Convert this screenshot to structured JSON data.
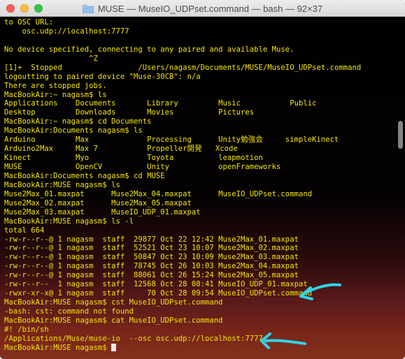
{
  "window": {
    "title": "MUSE — MuseIO_UDPset.command — bash — 92×37",
    "icon": "folder-icon"
  },
  "terminal": {
    "lines": [
      "to OSC URL:",
      "    osc.udp://localhost:7777",
      "",
      "No device specified, connecting to any paired and available Muse.",
      "                   ^Z",
      "[1]+  Stopped                 /Users/nagasm/Documents/MUSE/MuseIO_UDPset.command",
      "logoutting to paired device \"Muse-30CB\": n/a",
      "There are stopped jobs.",
      "MacBookAir:~ nagasm$ ls",
      "Applications    Documents       Library         Music           Public",
      "Desktop         Downloads       Movies          Pictures",
      "MacBookAir:~ nagasm$ cd Documents",
      "MacBookAir:Documents nagasm$ ls",
      "Arduino         Max             Processing      Unity勉強会     simpleKinect",
      "Arduino2Max     Max 7           Propeller開発   Xcode",
      "Kinect          Myo             Toyota          leapmotion",
      "MUSE            OpenCV          Unity           openFrameworks",
      "MacBookAir:Documents nagasm$ cd MUSE",
      "MacBookAir:MUSE nagasm$ ls",
      "Muse2Max_01.maxpat      Muse2Max_04.maxpat      MuseIO_UDPset.command",
      "Muse2Max_02.maxpat      Muse2Max_05.maxpat",
      "Muse2Max_03.maxpat      MuseIO_UDP_01.maxpat",
      "MacBookAir:MUSE nagasm$ ls -l",
      "total 664",
      "-rw-r--r--@ 1 nagasm  staff  29877 Oct 22 12:42 Muse2Max_01.maxpat",
      "-rw-r--r--@ 1 nagasm  staff  52521 Oct 23 10:07 Muse2Max_02.maxpat",
      "-rw-r--r--@ 1 nagasm  staff  50847 Oct 23 10:09 Muse2Max_03.maxpat",
      "-rw-r--r--@ 1 nagasm  staff  78745 Oct 26 10:03 Muse2Max_04.maxpat",
      "-rw-r--r--@ 1 nagasm  staff  88061 Oct 26 15:24 Muse2Max_05.maxpat",
      "-rw-r--r--  1 nagasm  staff  12568 Oct 28 08:41 MuseIO_UDP_01.maxpat",
      "-rwxr-xr-x@ 1 nagasm  staff     70 Oct 28 09:54 MuseIO_UDPset.command",
      "MacBookAir:MUSE nagasm$ cst MuseIO_UDPset.command",
      "-bash: cst: command not found",
      "MacBookAir:MUSE nagasm$ cat MuseIO_UDPset.command",
      "#! /bin/sh",
      "/Applications/Muse/muse-io  --osc osc.udp://localhost:7777",
      "MacBookAir:MUSE nagasm$ "
    ]
  },
  "colors": {
    "text": "#f2e600",
    "annotation_arrow": "#2fd4e6",
    "cursor": "#e8e8e8"
  }
}
